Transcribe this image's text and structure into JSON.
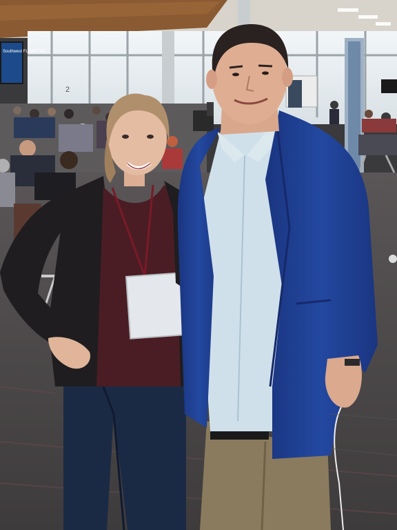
{
  "scene": {
    "gate_sign_text": "Southwest FLIGHT 362",
    "gate_number": "2",
    "colors": {
      "floor": "#4a4849",
      "ceiling_wood": "#8a5a32",
      "window_light": "#e8eef2",
      "jacket_woman": "#1f1d1f",
      "top_woman": "#4a1d24",
      "jeans": "#1b2a44",
      "blazer_man": "#1f3d8c",
      "shirt_man": "#cfe0ea",
      "pants_man": "#8a7b5e",
      "skin": "#e0b59a"
    },
    "icons": [
      "lanyard-badge-icon",
      "airport-seat-icon"
    ]
  }
}
